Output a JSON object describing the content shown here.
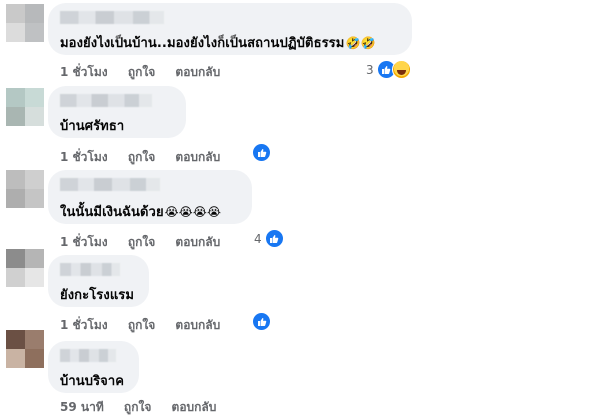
{
  "comments": [
    {
      "text": "มองยังไงเป็นบ้าน..มองยังไงก็เป็นสถานปฏิบัติธรรม",
      "text_emoji": "🤣🤣",
      "time": "1 ชั่วโมง",
      "like_label": "ถูกใจ",
      "reply_label": "ตอบกลับ",
      "reaction_count": "3",
      "reactions": [
        "like-icon",
        "haha-icon"
      ]
    },
    {
      "text": "บ้านศรัทธา",
      "text_emoji": "",
      "time": "1 ชั่วโมง",
      "like_label": "ถูกใจ",
      "reply_label": "ตอบกลับ",
      "reaction_count": "",
      "reactions": [
        "like-icon"
      ]
    },
    {
      "text": "ในนั้นมีเงินฉันด้วย",
      "text_emoji": "😭😭😭😭",
      "time": "1 ชั่วโมง",
      "like_label": "ถูกใจ",
      "reply_label": "ตอบกลับ",
      "reaction_count": "4",
      "reactions": [
        "like-icon"
      ]
    },
    {
      "text": "ยังกะโรงแรม",
      "text_emoji": "",
      "time": "1 ชั่วโมง",
      "like_label": "ถูกใจ",
      "reply_label": "ตอบกลับ",
      "reaction_count": "",
      "reactions": [
        "like-icon"
      ]
    },
    {
      "text": "บ้านบริจาค",
      "text_emoji": "",
      "time": "59 นาที",
      "like_label": "ถูกใจ",
      "reply_label": "ตอบกลับ",
      "reaction_count": "",
      "reactions": []
    }
  ],
  "colors": {
    "bubble": "#f0f2f5",
    "meta_text": "#65676b",
    "like_blue": "#1877f2"
  }
}
